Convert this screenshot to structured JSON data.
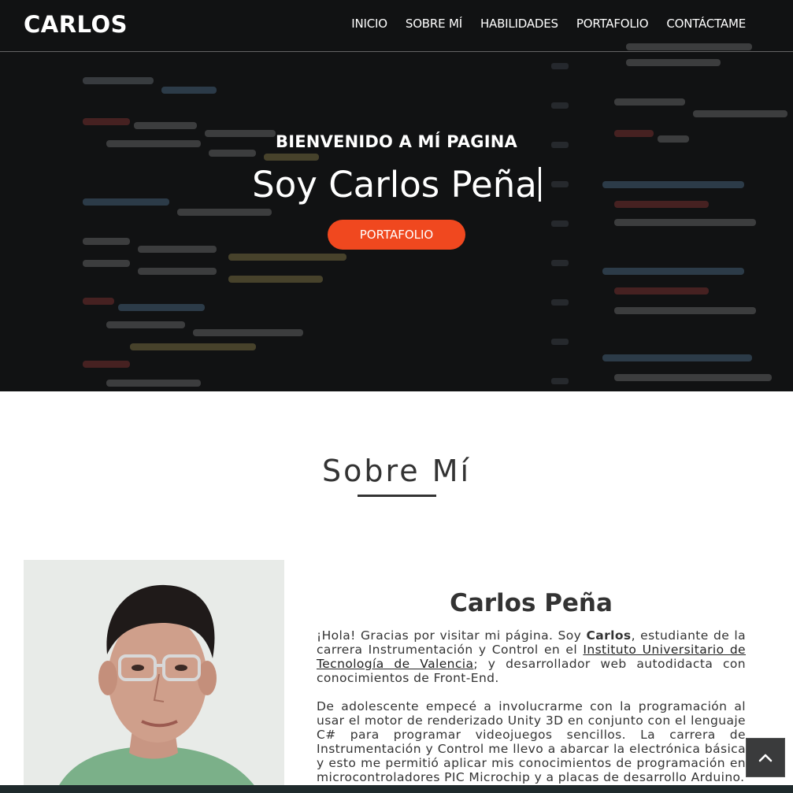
{
  "navbar": {
    "brand": "CARLOS",
    "links": [
      "INICIO",
      "SOBRE MÍ",
      "HABILIDADES",
      "PORTAFOLIO",
      "CONTÁCTAME"
    ]
  },
  "hero": {
    "kicker": "BIENVENIDO A MÍ PAGINA",
    "title": "Soy Carlos Peña",
    "button_label": "PORTAFOLIO"
  },
  "about": {
    "section_title": "Sobre Mí",
    "name": "Carlos Peña",
    "p1": {
      "t1": "¡Hola! Gracias por visitar mi página. Soy ",
      "strong": "Carlos",
      "t2": ", estudiante de la carrera Instrumentación y Control en el ",
      "link": "Instituto Universitario de Tecnología de Valencia",
      "t3": "; y desarrollador web autodidacta con conocimientos de Front-End."
    },
    "p2": "De adolescente empecé a involucrarme con la programación al usar el motor de renderizado Unity 3D en conjunto con el lenguaje C# para programar videojuegos sencillos. La carrera de Instrumentación y Control me llevo a abarcar la electrónica básica y esto me permitió aplicar mis conocimientos de programación en microcontroladores PIC Microchip y a placas de desarrollo Arduino."
  },
  "colors": {
    "accent": "#f0481f",
    "hero_bg": "#16181b",
    "text": "#333333"
  },
  "icons": {
    "scroll_top": "chevron-up-icon"
  }
}
